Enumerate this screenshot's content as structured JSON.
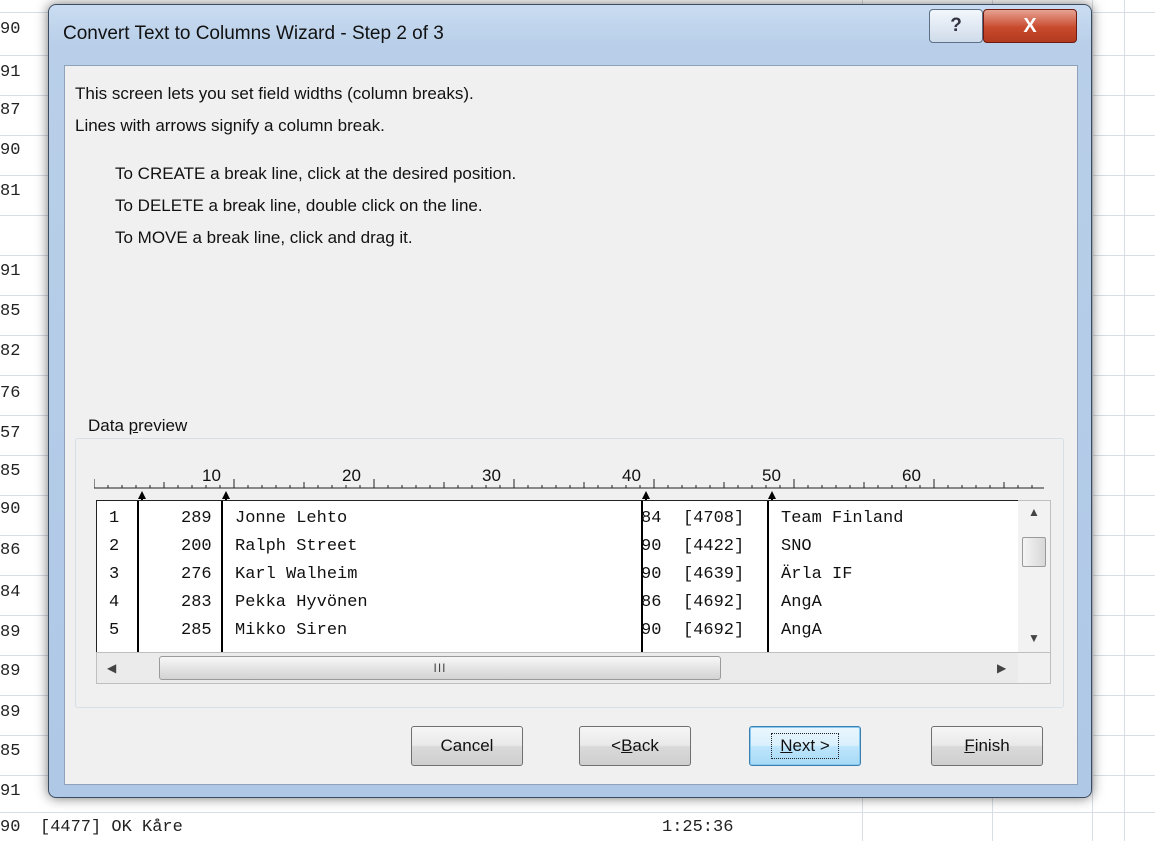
{
  "background_sheet": {
    "row_fragments": [
      "90",
      "91",
      "87",
      "90",
      "81",
      "",
      "91",
      "85",
      "82",
      "76",
      "57",
      "85",
      "90",
      "86",
      "84",
      "89",
      "89",
      "89",
      "85",
      "91",
      "90"
    ],
    "bottom_row": {
      "number": "90",
      "team": "[4477] OK Kåre",
      "time": "1:25:36"
    }
  },
  "dialog": {
    "title": "Convert Text to Columns Wizard - Step 2 of 3",
    "help_label": "?",
    "close_label": "X",
    "intro": [
      "This screen lets you set field widths (column breaks).",
      "Lines with arrows signify a column break."
    ],
    "instructions": [
      "To CREATE a break line, click at the desired position.",
      "To DELETE a break line, double click on the line.",
      "To MOVE a break line, click and drag it."
    ],
    "preview": {
      "label_prefix": "Data ",
      "label_accel": "p",
      "label_suffix": "review",
      "ruler_ticks": [
        "10",
        "20",
        "30",
        "40",
        "50",
        "60"
      ],
      "rows": [
        {
          "row": "1",
          "bib": "289",
          "name": "Jonne Lehto",
          "year": "84",
          "club_id": "[4708]",
          "club": "Team Finland"
        },
        {
          "row": "2",
          "bib": "200",
          "name": "Ralph Street",
          "year": "90",
          "club_id": "[4422]",
          "club": "SNO"
        },
        {
          "row": "3",
          "bib": "276",
          "name": "Karl Walheim",
          "year": "90",
          "club_id": "[4639]",
          "club": "Ärla IF"
        },
        {
          "row": "4",
          "bib": "283",
          "name": "Pekka Hyvönen",
          "year": "86",
          "club_id": "[4692]",
          "club": "AngA"
        },
        {
          "row": "5",
          "bib": "285",
          "name": "Mikko Siren",
          "year": "90",
          "club_id": "[4692]",
          "club": "AngA"
        }
      ],
      "hscroll_grip": "III"
    },
    "buttons": {
      "cancel": "Cancel",
      "back_prefix": "< ",
      "back_accel": "B",
      "back_suffix": "ack",
      "next_accel": "N",
      "next_suffix": "ext >",
      "finish_accel": "F",
      "finish_suffix": "inish"
    }
  }
}
